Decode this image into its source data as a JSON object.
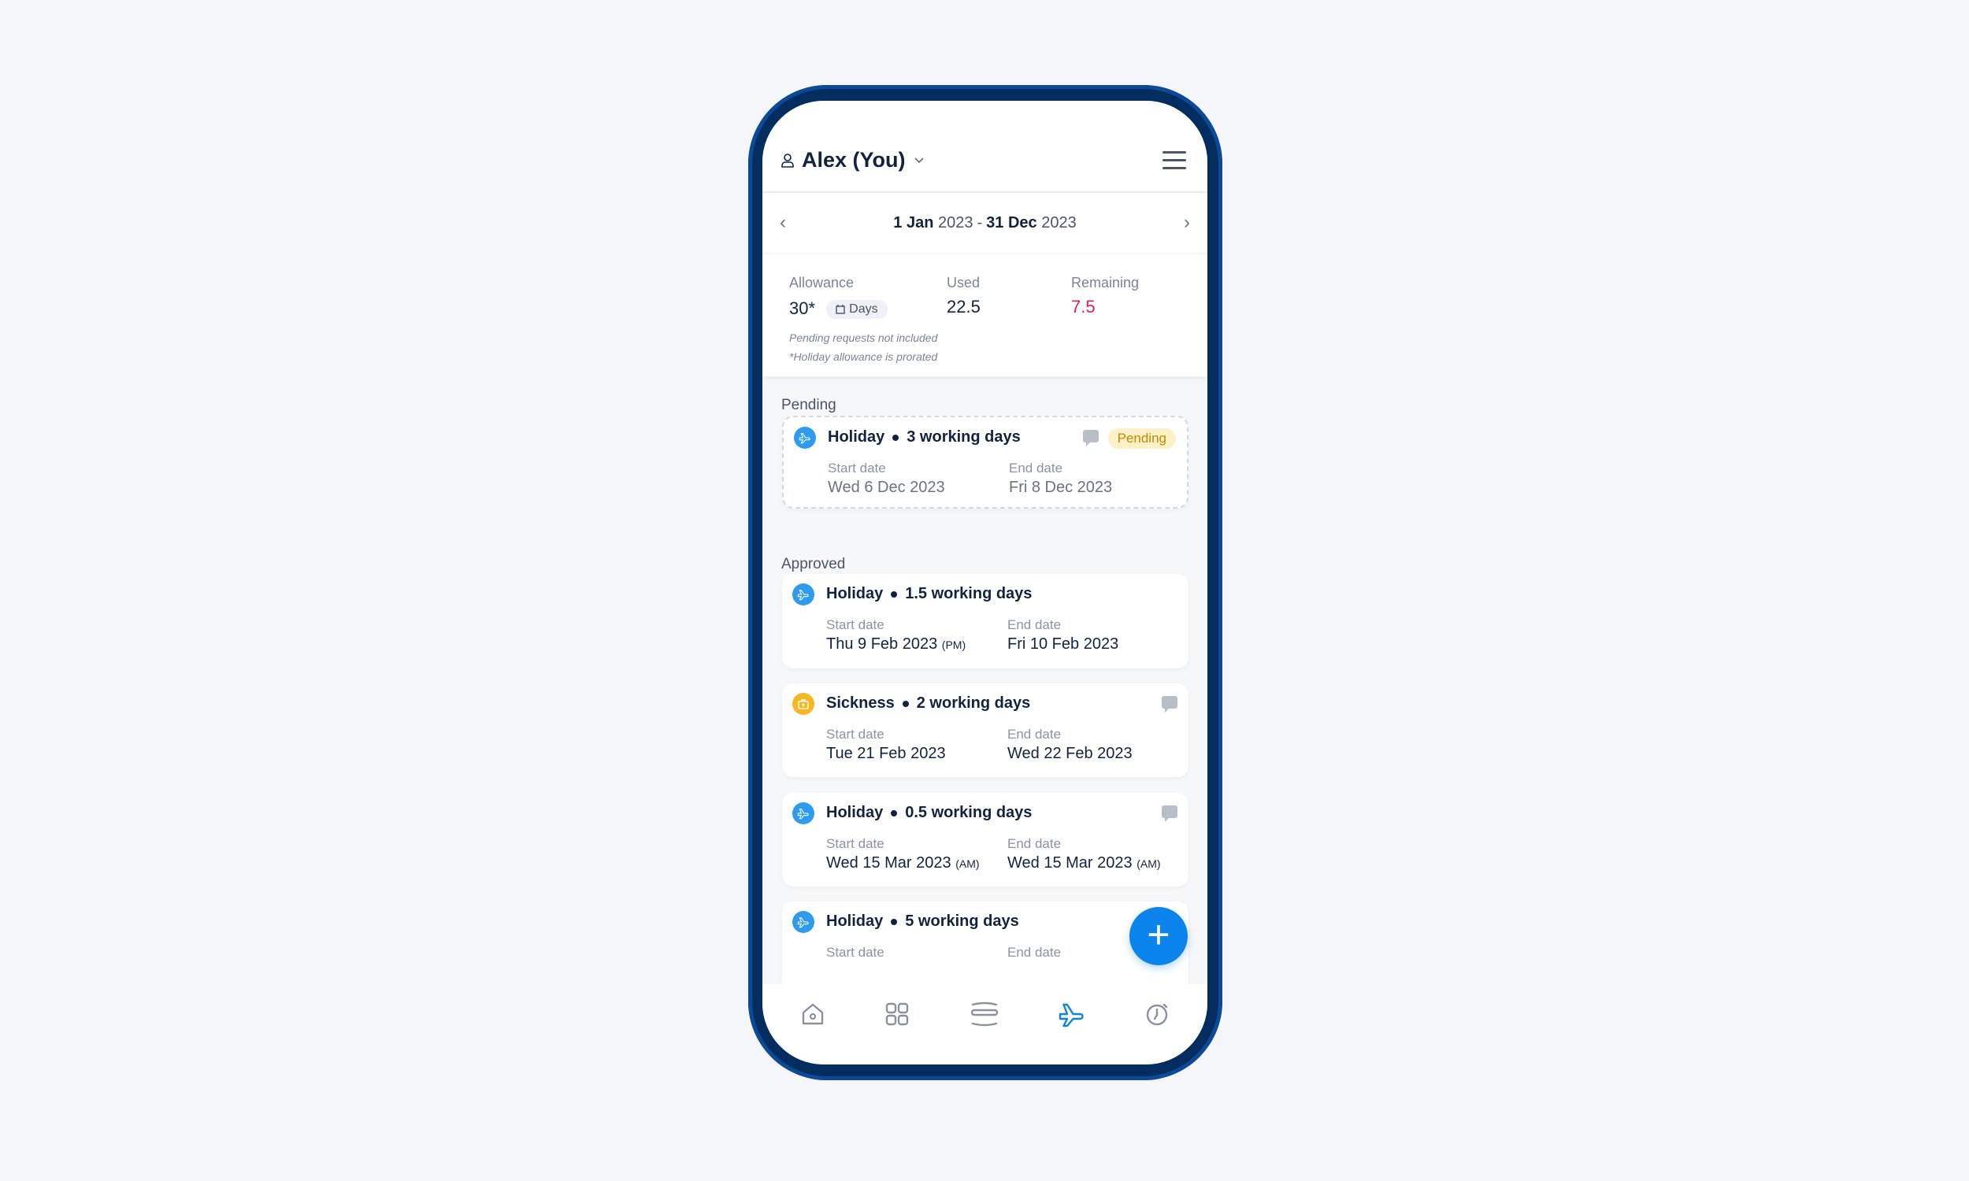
{
  "header": {
    "user_name": "Alex (You)",
    "icons": [
      "user-icon",
      "chevron-down-icon",
      "hamburger-menu-icon"
    ]
  },
  "period": {
    "start_day": "1 Jan",
    "start_year": "2023",
    "separator": "-",
    "end_day": "31 Dec",
    "end_year": "2023"
  },
  "stats": {
    "allowance_label": "Allowance",
    "allowance_value": "30*",
    "unit": "Days",
    "used_label": "Used",
    "used_value": "22.5",
    "remaining_label": "Remaining",
    "remaining_value": "7.5",
    "note1": "Pending requests not included",
    "note2": "*Holiday allowance is prorated"
  },
  "colors": {
    "accent": "#0b84ee",
    "remaining": "#e0234e",
    "holiday": "#2d9cf0",
    "sickness": "#f5b820",
    "pending_badge": "#fdf1c7"
  },
  "sections": {
    "pending": "Pending",
    "approved": "Approved"
  },
  "labels": {
    "start": "Start date",
    "end": "End date"
  },
  "pending": [
    {
      "type": "Holiday",
      "duration": "3 working days",
      "start": "Wed 6 Dec 2023",
      "start_suffix": "",
      "end": "Fri 8 Dec 2023",
      "end_suffix": "",
      "badge": "Pending",
      "has_comment": true
    }
  ],
  "approved": [
    {
      "type": "Holiday",
      "duration": "1.5 working days",
      "start": "Thu 9 Feb 2023",
      "start_suffix": "(PM)",
      "end": "Fri 10 Feb 2023",
      "end_suffix": "",
      "has_comment": false
    },
    {
      "type": "Sickness",
      "duration": "2 working days",
      "start": "Tue 21 Feb 2023",
      "start_suffix": "",
      "end": "Wed 22 Feb 2023",
      "end_suffix": "",
      "has_comment": true
    },
    {
      "type": "Holiday",
      "duration": "0.5 working days",
      "start": "Wed 15 Mar 2023",
      "start_suffix": "(AM)",
      "end": "Wed 15 Mar 2023",
      "end_suffix": "(AM)",
      "has_comment": true
    },
    {
      "type": "Holiday",
      "duration": "5 working days"
    }
  ],
  "fab": "+",
  "nav": [
    "home-icon",
    "grid-icon",
    "schedule-icon",
    "plane-icon",
    "clock-icon"
  ],
  "nav_active": "plane-icon"
}
